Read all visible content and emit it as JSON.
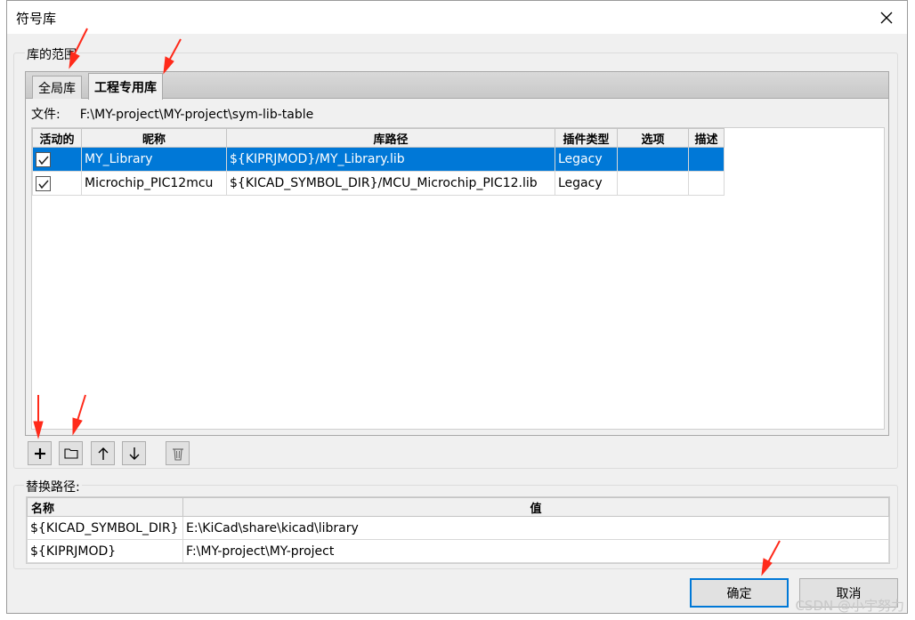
{
  "window": {
    "title": "符号库",
    "close_label": "✕"
  },
  "library_scope": {
    "group_label": "库的范围",
    "tabs": [
      {
        "label": "全局库",
        "active": false
      },
      {
        "label": "工程专用库",
        "active": true
      }
    ],
    "file_label": "文件:",
    "file_path": "F:\\MY-project\\MY-project\\sym-lib-table",
    "columns": [
      "活动的",
      "昵称",
      "库路径",
      "插件类型",
      "选项",
      "描述"
    ],
    "rows": [
      {
        "active": true,
        "nickname": "MY_Library",
        "path": "${KIPRJMOD}/MY_Library.lib",
        "plugin": "Legacy",
        "options": "",
        "description": "",
        "selected": true
      },
      {
        "active": true,
        "nickname": "Microchip_PIC12mcu",
        "path": "${KICAD_SYMBOL_DIR}/MCU_Microchip_PIC12.lib",
        "plugin": "Legacy",
        "options": "",
        "description": "",
        "selected": false
      }
    ],
    "toolbar": {
      "add_icon": "plus-icon",
      "folder_icon": "folder-icon",
      "up_icon": "arrow-up-icon",
      "down_icon": "arrow-down-icon",
      "delete_icon": "trash-icon"
    }
  },
  "path_substitutions": {
    "group_label": "替换路径:",
    "columns": [
      "名称",
      "值"
    ],
    "rows": [
      {
        "name": "${KICAD_SYMBOL_DIR}",
        "value": "E:\\KiCad\\share\\kicad\\library"
      },
      {
        "name": "${KIPRJMOD}",
        "value": "F:\\MY-project\\MY-project"
      }
    ]
  },
  "footer": {
    "ok_label": "确定",
    "cancel_label": "取消"
  },
  "watermark": "CSDN @小宇努力",
  "colors": {
    "selection": "#0078d7",
    "annotation_arrow": "#ff2a1a"
  }
}
